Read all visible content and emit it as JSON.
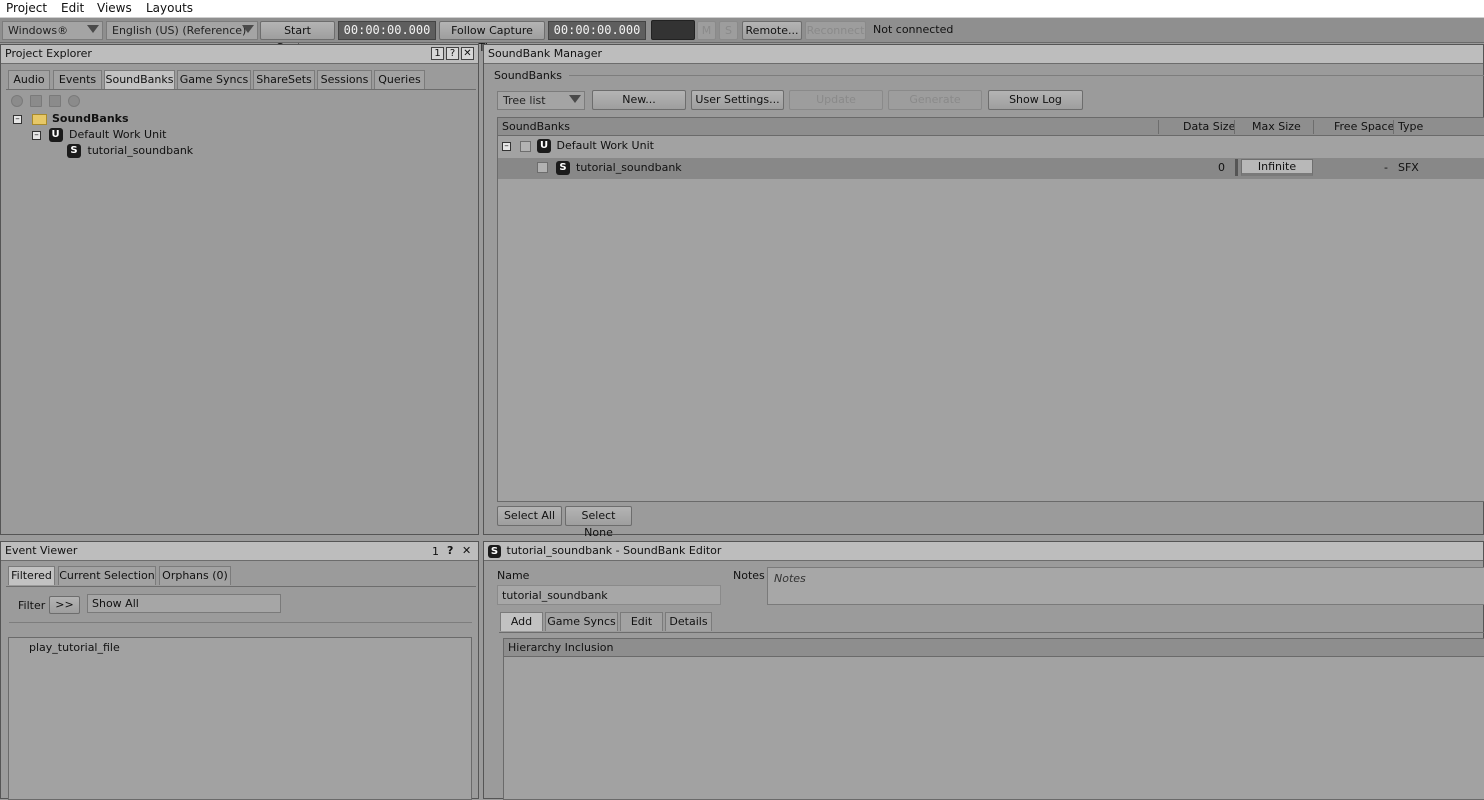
{
  "menu": [
    "Project",
    "Edit",
    "Views",
    "Layouts"
  ],
  "toolbar": {
    "platform": "Windows®",
    "language": "English (US) (Reference)",
    "start_capture": "Start Capture",
    "timer1": "00:00:00.000",
    "follow_capture": "Follow Capture Time",
    "timer2": "00:00:00.000",
    "m": "M",
    "s": "S",
    "remote": "Remote...",
    "reconnect": "Reconnect",
    "status": "Not connected"
  },
  "project_explorer": {
    "title": "Project Explorer",
    "tabs": [
      "Audio",
      "Events",
      "SoundBanks",
      "Game Syncs",
      "ShareSets",
      "Sessions",
      "Queries"
    ],
    "tree": {
      "root": "SoundBanks",
      "unit": "Default Work Unit",
      "bank": "tutorial_soundbank"
    }
  },
  "soundbank_manager": {
    "title": "SoundBank Manager",
    "section": "SoundBanks",
    "view_mode": "Tree list",
    "buttons": {
      "new": "New...",
      "user_settings": "User Settings...",
      "update": "Update",
      "generate": "Generate",
      "show_log": "Show Log"
    },
    "columns": {
      "name": "SoundBanks",
      "data_size": "Data Size",
      "max_size": "Max Size",
      "free_space": "Free Space",
      "type": "Type"
    },
    "rows": [
      {
        "name": "Default Work Unit"
      },
      {
        "name": "tutorial_soundbank",
        "data_size": "0",
        "max_size": "Infinite",
        "free_space": "-",
        "type": "SFX"
      }
    ],
    "select_all": "Select All",
    "select_none": "Select None"
  },
  "event_viewer": {
    "title": "Event Viewer",
    "tabs": [
      "Filtered",
      "Current Selection",
      "Orphans (0)"
    ],
    "filter_label": "Filter",
    "filter_button": ">>",
    "filter_value": "Show All",
    "items": [
      "play_tutorial_file"
    ]
  },
  "soundbank_editor": {
    "title": "tutorial_soundbank - SoundBank Editor",
    "name_label": "Name",
    "name_value": "tutorial_soundbank",
    "notes_label": "Notes",
    "notes_placeholder": "Notes",
    "tabs": [
      "Add",
      "Game Syncs",
      "Edit",
      "Details"
    ],
    "hierarchy_header": "Hierarchy Inclusion"
  },
  "panel_buttons": {
    "pin": "1",
    "help": "?",
    "close": "✕"
  },
  "icons": {
    "unit": "U",
    "bank": "S"
  }
}
